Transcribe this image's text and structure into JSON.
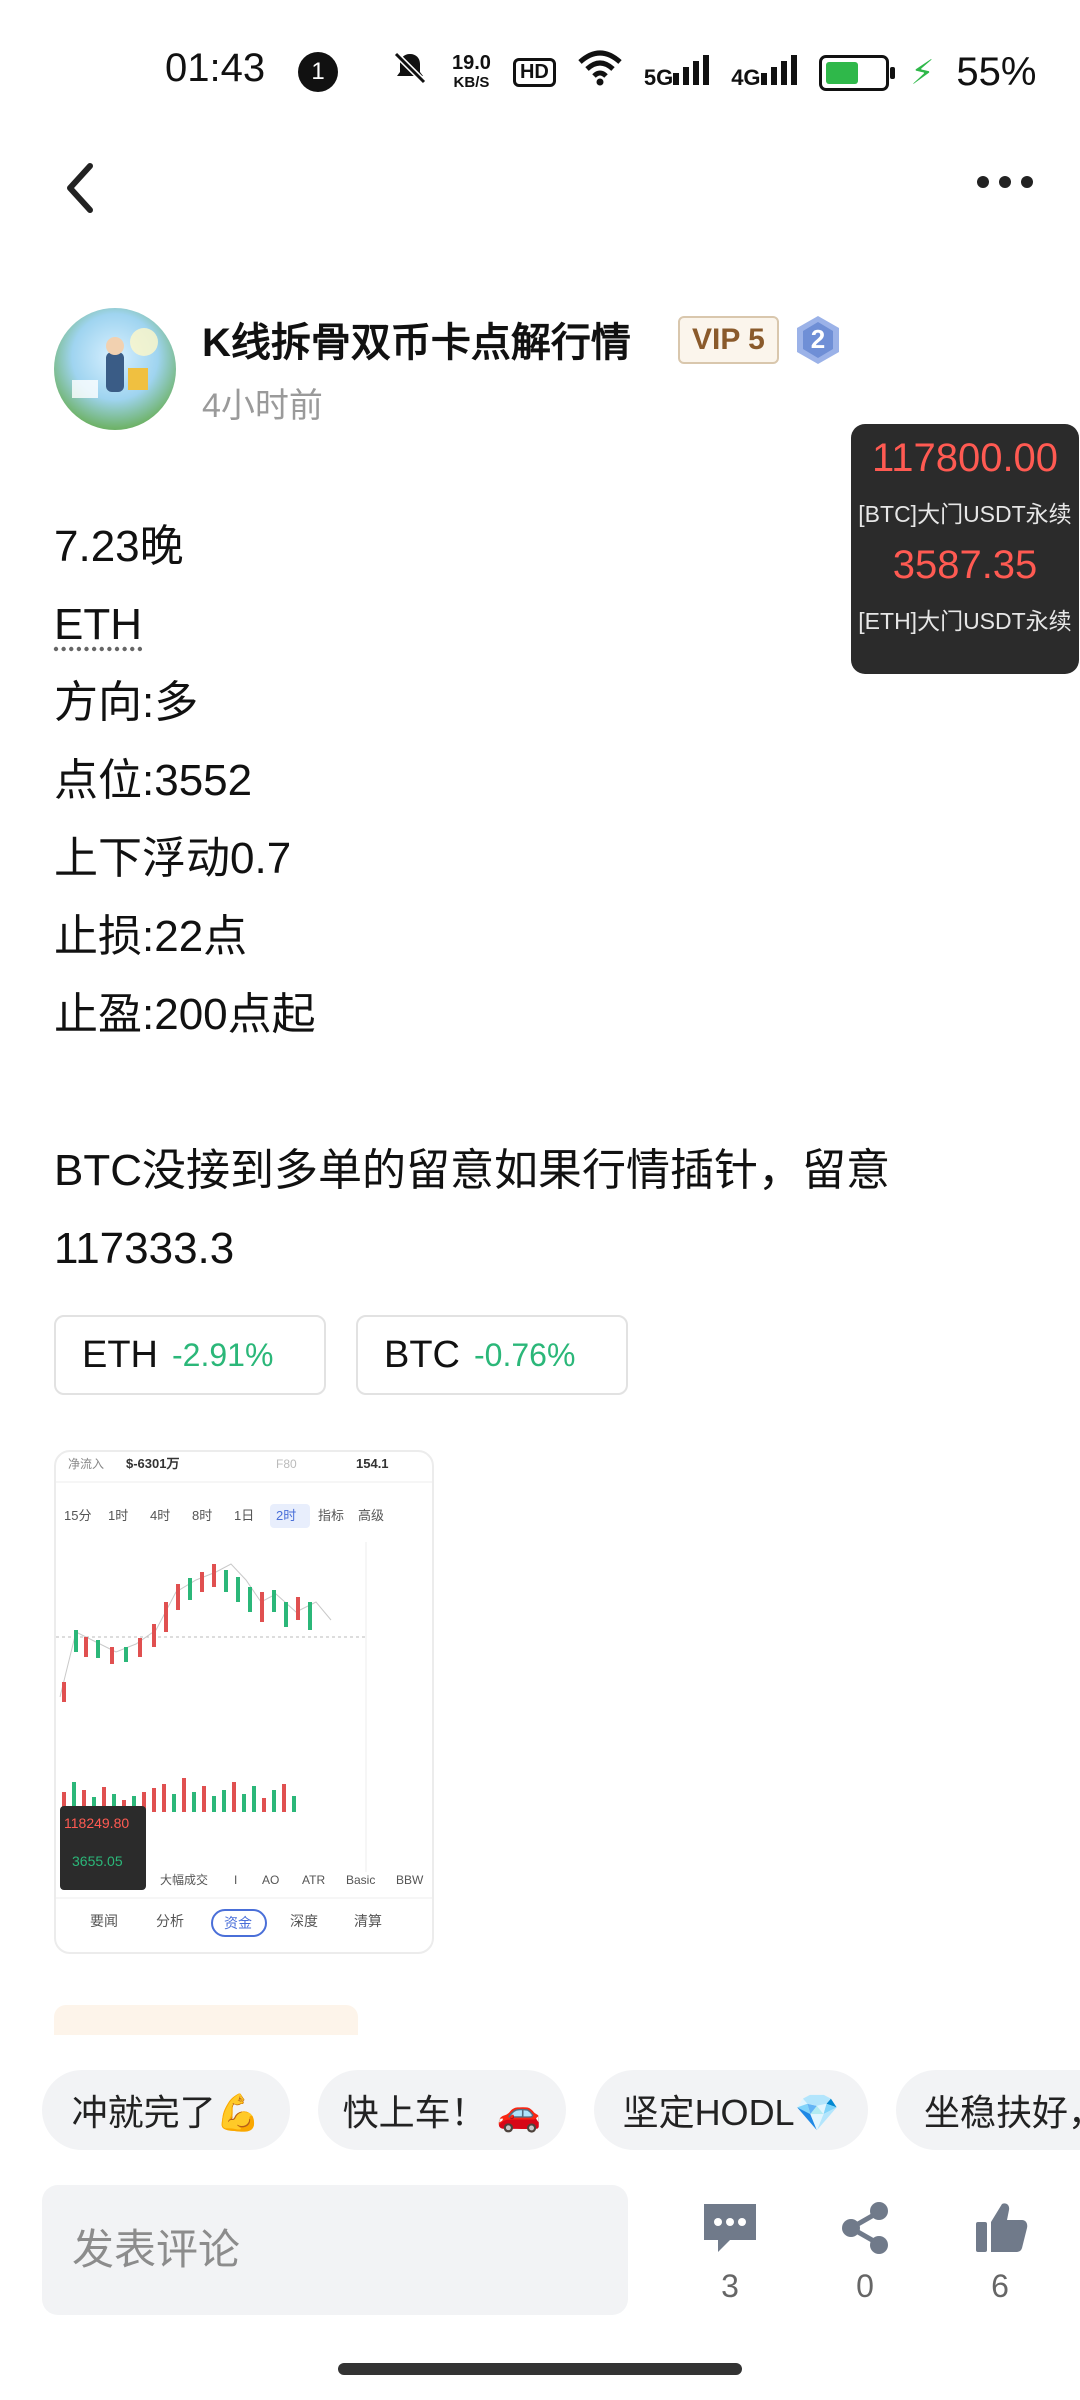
{
  "status_bar": {
    "time": "01:43",
    "notification_count": "1",
    "net_speed_value": "19.0",
    "net_speed_unit": "KB/S",
    "hd_label": "HD",
    "sig1": "5G",
    "sig2": "4G",
    "battery_percent": "55%",
    "battery_level": 0.55,
    "battery_color": "#2fb84a"
  },
  "nav": {
    "back_icon": "chevron-left-icon",
    "more_icon": "more-dots-icon"
  },
  "author": {
    "name": "K线拆骨双币卡点解行情",
    "vip_badge": "VIP 5",
    "level_badge": "2",
    "posted_ago": "4小时前"
  },
  "price_widget": {
    "btc_price": "117800.00",
    "btc_label": "[BTC]大门USDT永续",
    "eth_price": "3587.35",
    "eth_label": "[ETH]大门USDT永续",
    "price_color": "#ff5a52"
  },
  "post": {
    "lines": [
      "7.23晚",
      "ETH",
      "方向:多",
      "点位:3552",
      "上下浮动0.7",
      "止损:22点",
      "止盈:200点起"
    ],
    "paragraph_line1": "BTC没接到多单的留意如果行情插针，留意",
    "paragraph_line2": "117333.3"
  },
  "tickers": [
    {
      "symbol": "ETH",
      "change": "-2.91%"
    },
    {
      "symbol": "BTC",
      "change": "-0.76%"
    }
  ],
  "chart_thumb": {
    "top_flow_label": "净流入",
    "top_flow_value": "$-6301万",
    "top_mid": "F80",
    "top_right": "154.1",
    "timeframes": [
      "15分",
      "1时",
      "4时",
      "8时",
      "1日",
      "2时",
      "指标",
      "高级"
    ],
    "indicators": [
      "大幅成交",
      "I",
      "AO",
      "ATR",
      "Basic",
      "BBW"
    ],
    "bottom_tabs": [
      "要闻",
      "分析",
      "资金",
      "深度",
      "清算"
    ],
    "mini_price1": "118249.80",
    "mini_price2": "3655.05"
  },
  "quick_replies": [
    "冲就完了💪",
    "快上车！ 🚗",
    "坚定HODL💎",
    "坐稳扶好，"
  ],
  "bottom_bar": {
    "comment_placeholder": "发表评论",
    "comments_count": "3",
    "shares_count": "0",
    "likes_count": "6"
  },
  "colors": {
    "up_green": "#2bb779",
    "down_red": "#ff5a52"
  }
}
